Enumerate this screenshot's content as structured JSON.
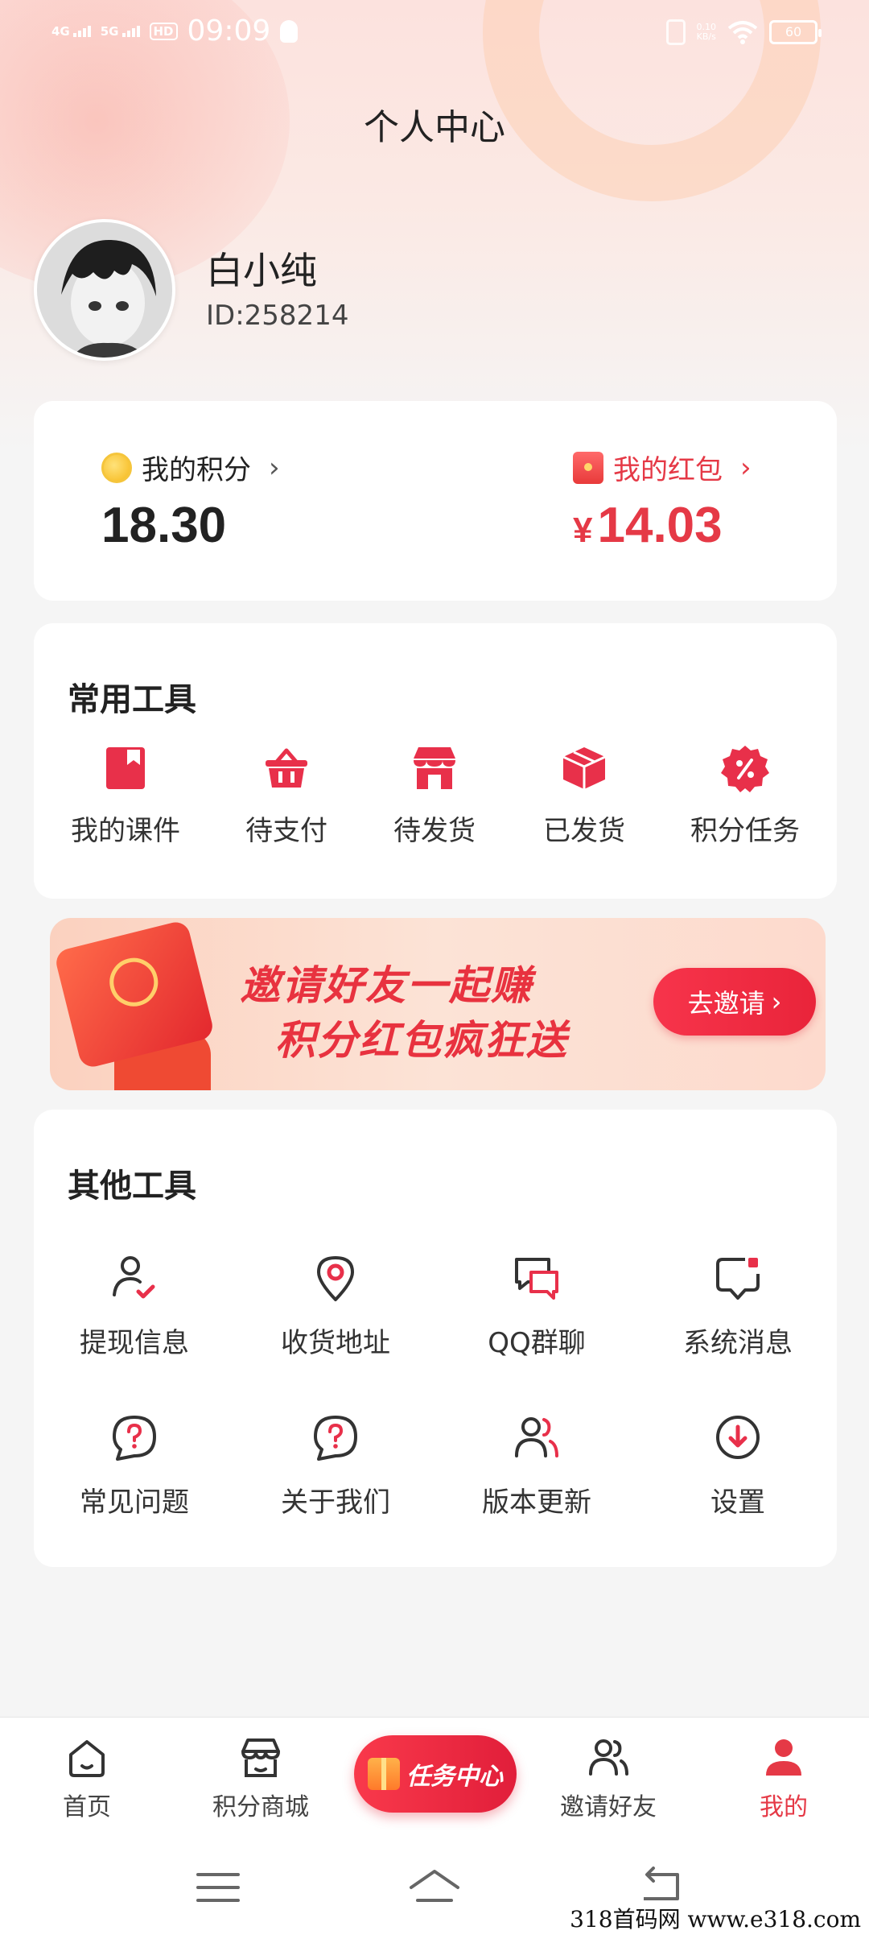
{
  "status_bar": {
    "signal_1": "4G",
    "signal_2": "5G",
    "hd_label": "HD",
    "time": "09:09",
    "net_speed_value": "0.10",
    "net_speed_unit": "KB/s",
    "battery": "60"
  },
  "header": {
    "title": "个人中心"
  },
  "profile": {
    "name": "白小纯",
    "id_text": "ID:258214"
  },
  "assets": {
    "points_label": "我的积分",
    "points_value": "18.30",
    "redpack_label": "我的红包",
    "currency_symbol": "¥",
    "redpack_value": "14.03"
  },
  "common_tools": {
    "title": "常用工具",
    "items": [
      {
        "label": "我的课件",
        "icon": "courseware-icon"
      },
      {
        "label": "待支付",
        "icon": "basket-icon"
      },
      {
        "label": "待发货",
        "icon": "store-icon"
      },
      {
        "label": "已发货",
        "icon": "box-icon"
      },
      {
        "label": "积分任务",
        "icon": "percent-badge-icon"
      }
    ]
  },
  "banner": {
    "line1": "邀请好友一起赚",
    "line2": "积分红包疯狂送",
    "button_label": "去邀请"
  },
  "other_tools": {
    "title": "其他工具",
    "items": [
      {
        "label": "提现信息",
        "icon": "user-check-icon"
      },
      {
        "label": "收货地址",
        "icon": "location-pin-icon"
      },
      {
        "label": "QQ群聊",
        "icon": "chat-bubbles-icon"
      },
      {
        "label": "系统消息",
        "icon": "message-dot-icon"
      },
      {
        "label": "常见问题",
        "icon": "question-bubble-icon"
      },
      {
        "label": "关于我们",
        "icon": "question-bubble-icon"
      },
      {
        "label": "版本更新",
        "icon": "users-icon"
      },
      {
        "label": "设置",
        "icon": "download-circle-icon"
      }
    ]
  },
  "tab_bar": {
    "tabs": [
      {
        "label": "首页",
        "icon": "home-icon",
        "active": false
      },
      {
        "label": "积分商城",
        "icon": "shop-icon",
        "active": false
      },
      {
        "label": "任务中心",
        "icon": "gift-icon",
        "active": false
      },
      {
        "label": "邀请好友",
        "icon": "users-icon",
        "active": false
      },
      {
        "label": "我的",
        "icon": "person-icon",
        "active": true
      }
    ]
  },
  "watermark": "318首码网  www.e318.com",
  "colors": {
    "accent": "#e53946",
    "tool_icon": "#e8304a",
    "text": "#222222",
    "background": "#f5f5f5"
  }
}
